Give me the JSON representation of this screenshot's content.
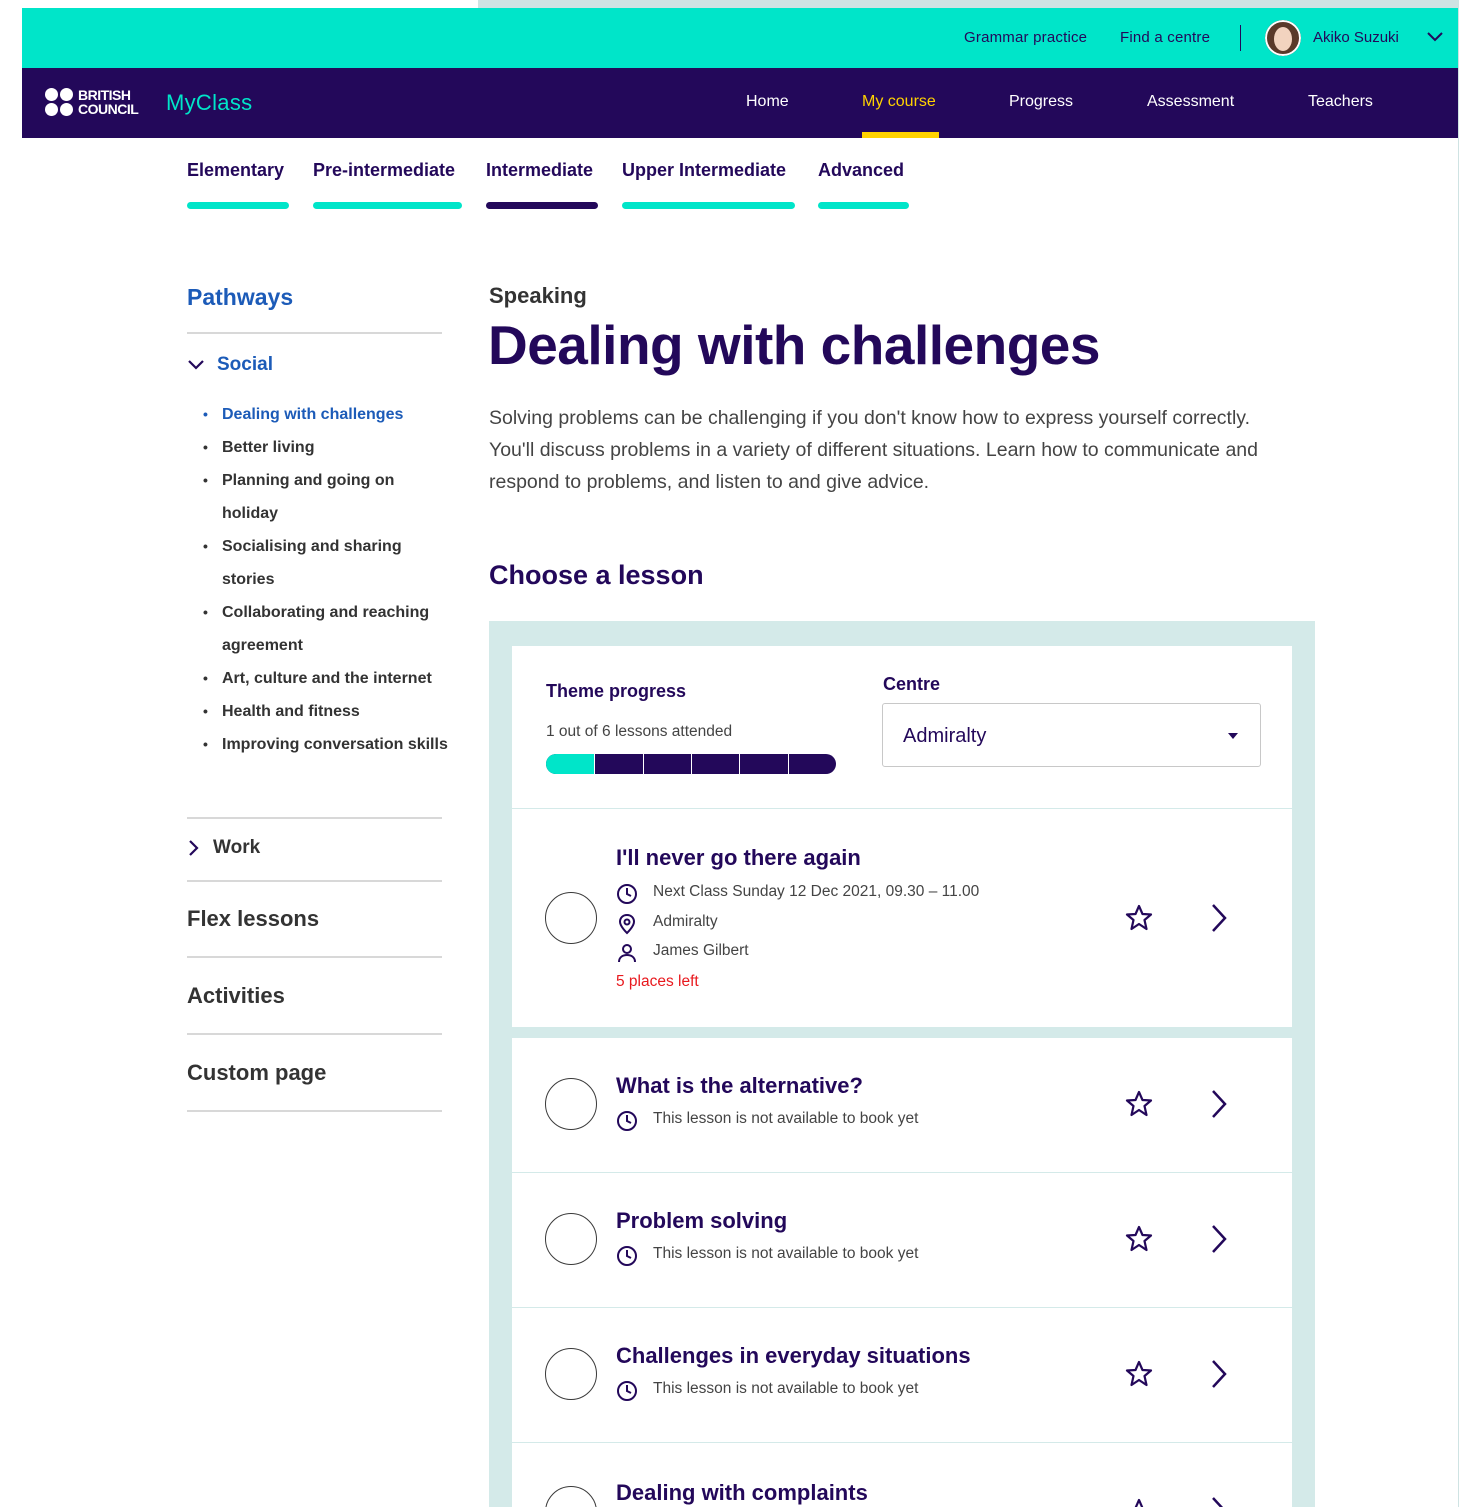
{
  "utility": {
    "grammar_practice": "Grammar practice",
    "find_centre": "Find a centre",
    "user_name": "Akiko Suzuki"
  },
  "nav": {
    "logo_line1": "BRITISH",
    "logo_line2": "COUNCIL",
    "brand": "MyClass",
    "items": [
      {
        "label": "Home"
      },
      {
        "label": "My course",
        "active": true
      },
      {
        "label": "Progress"
      },
      {
        "label": "Assessment"
      },
      {
        "label": "Teachers"
      }
    ]
  },
  "levels": [
    {
      "label": "Elementary"
    },
    {
      "label": "Pre-intermediate"
    },
    {
      "label": "Intermediate",
      "active": true
    },
    {
      "label": "Upper Intermediate"
    },
    {
      "label": "Advanced"
    }
  ],
  "sidebar": {
    "title": "Pathways",
    "section": "Social",
    "items": [
      "Dealing with challenges",
      "Better living",
      "Planning and going on holiday",
      "Socialising and sharing stories",
      "Collaborating and reaching agreement",
      "Art, culture and the internet",
      "Health and fitness",
      "Improving conversation skills"
    ],
    "current_item": "Dealing with challenges",
    "work": "Work",
    "flex": "Flex lessons",
    "activities": "Activities",
    "custom": "Custom page"
  },
  "main": {
    "kicker": "Speaking",
    "heading": "Dealing with challenges",
    "intro": "Solving problems can be challenging if you don't know how to express yourself correctly. You'll discuss problems in a variety of different situations. Learn how to communicate and respond to problems, and listen to and give advice.",
    "choose": "Choose a lesson"
  },
  "progress": {
    "label": "Theme progress",
    "summary": "1 out of 6 lessons attended",
    "attended": 1,
    "total": 6
  },
  "centre": {
    "label": "Centre",
    "selected": "Admiralty"
  },
  "lessons": [
    {
      "title": "I'll never go there again",
      "next_class": "Next Class Sunday 12 Dec 2021, 09.30 – 11.00",
      "location": "Admiralty",
      "teacher": "James Gilbert",
      "places": "5 places left"
    },
    {
      "title": "What is the alternative?",
      "status": "This lesson is not available to book yet"
    },
    {
      "title": "Problem solving",
      "status": "This lesson is not available to book yet"
    },
    {
      "title": "Challenges in everyday situations",
      "status": "This lesson is not available to book yet"
    },
    {
      "title": "Dealing with complaints"
    }
  ],
  "colors": {
    "teal": "#00e5c9",
    "navy": "#23085a",
    "link_blue": "#1c5bb8",
    "active_yellow": "#ffd200",
    "alert_red": "#e8191e",
    "panel_bg": "#d4eae9"
  }
}
